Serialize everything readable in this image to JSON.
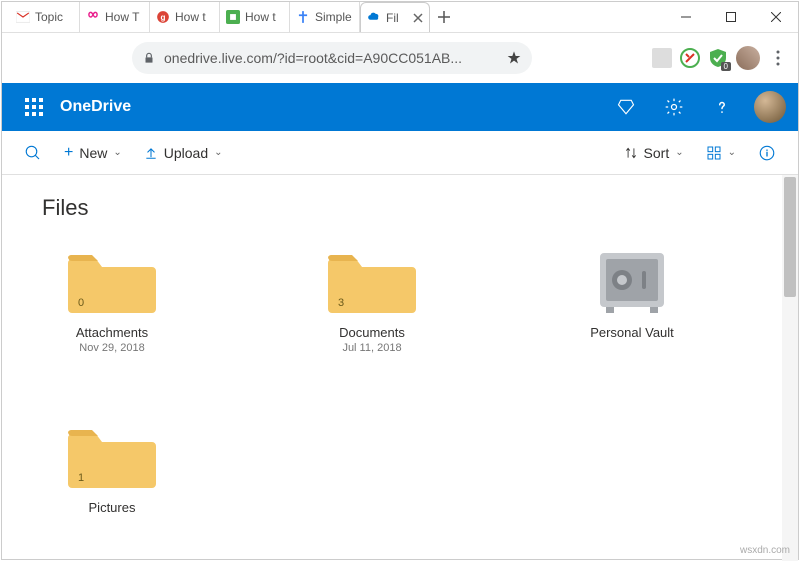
{
  "browser": {
    "tabs": [
      {
        "label": "Topic",
        "icon": "gmail"
      },
      {
        "label": "How T",
        "icon": "pink"
      },
      {
        "label": "How t",
        "icon": "google"
      },
      {
        "label": "How t",
        "icon": "green"
      },
      {
        "label": "Simple",
        "icon": "blue"
      },
      {
        "label": "Fil",
        "icon": "onedrive",
        "active": true
      }
    ],
    "url": "onedrive.live.com/?id=root&cid=A90CC051AB...",
    "ext_badge": "0"
  },
  "header": {
    "brand": "OneDrive"
  },
  "toolbar": {
    "new_label": "New",
    "upload_label": "Upload",
    "sort_label": "Sort"
  },
  "page": {
    "title": "Files",
    "items": [
      {
        "name": "Attachments",
        "date": "Nov 29, 2018",
        "count": "0",
        "type": "folder"
      },
      {
        "name": "Documents",
        "date": "Jul 11, 2018",
        "count": "3",
        "type": "folder"
      },
      {
        "name": "Personal Vault",
        "date": "",
        "type": "vault"
      },
      {
        "name": "Pictures",
        "date": "",
        "count": "1",
        "type": "folder"
      }
    ]
  },
  "watermark": "wsxdn.com"
}
